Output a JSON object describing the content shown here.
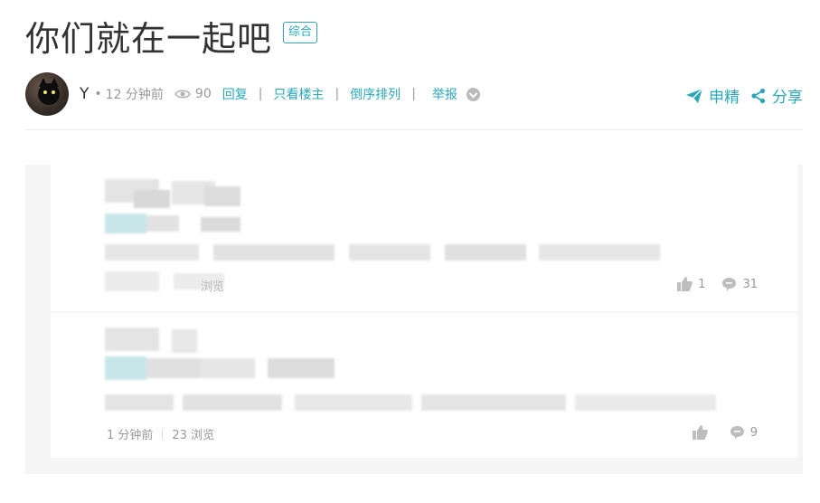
{
  "post": {
    "title": "你们就在一起吧",
    "tag": "综合",
    "author": "Y",
    "time_ago": "12 分钟前",
    "views": "90",
    "links": [
      "回复",
      "只看楼主",
      "倒序排列"
    ],
    "report": "举报",
    "actions": {
      "apply_featured": "申精",
      "share": "分享"
    }
  },
  "replies": [
    {
      "time": "",
      "views_label": "浏览",
      "likes": "1",
      "comments": "31"
    },
    {
      "time": "1 分钟前",
      "views_label": "23 浏览",
      "likes": "",
      "comments": "9"
    }
  ],
  "colors": {
    "accent": "#2aa8b8",
    "muted": "#999999",
    "text": "#333333"
  },
  "icons": [
    "eye-icon",
    "chevron-down-icon",
    "paper-plane-icon",
    "share-icon",
    "thumbs-up-icon",
    "comment-icon"
  ]
}
